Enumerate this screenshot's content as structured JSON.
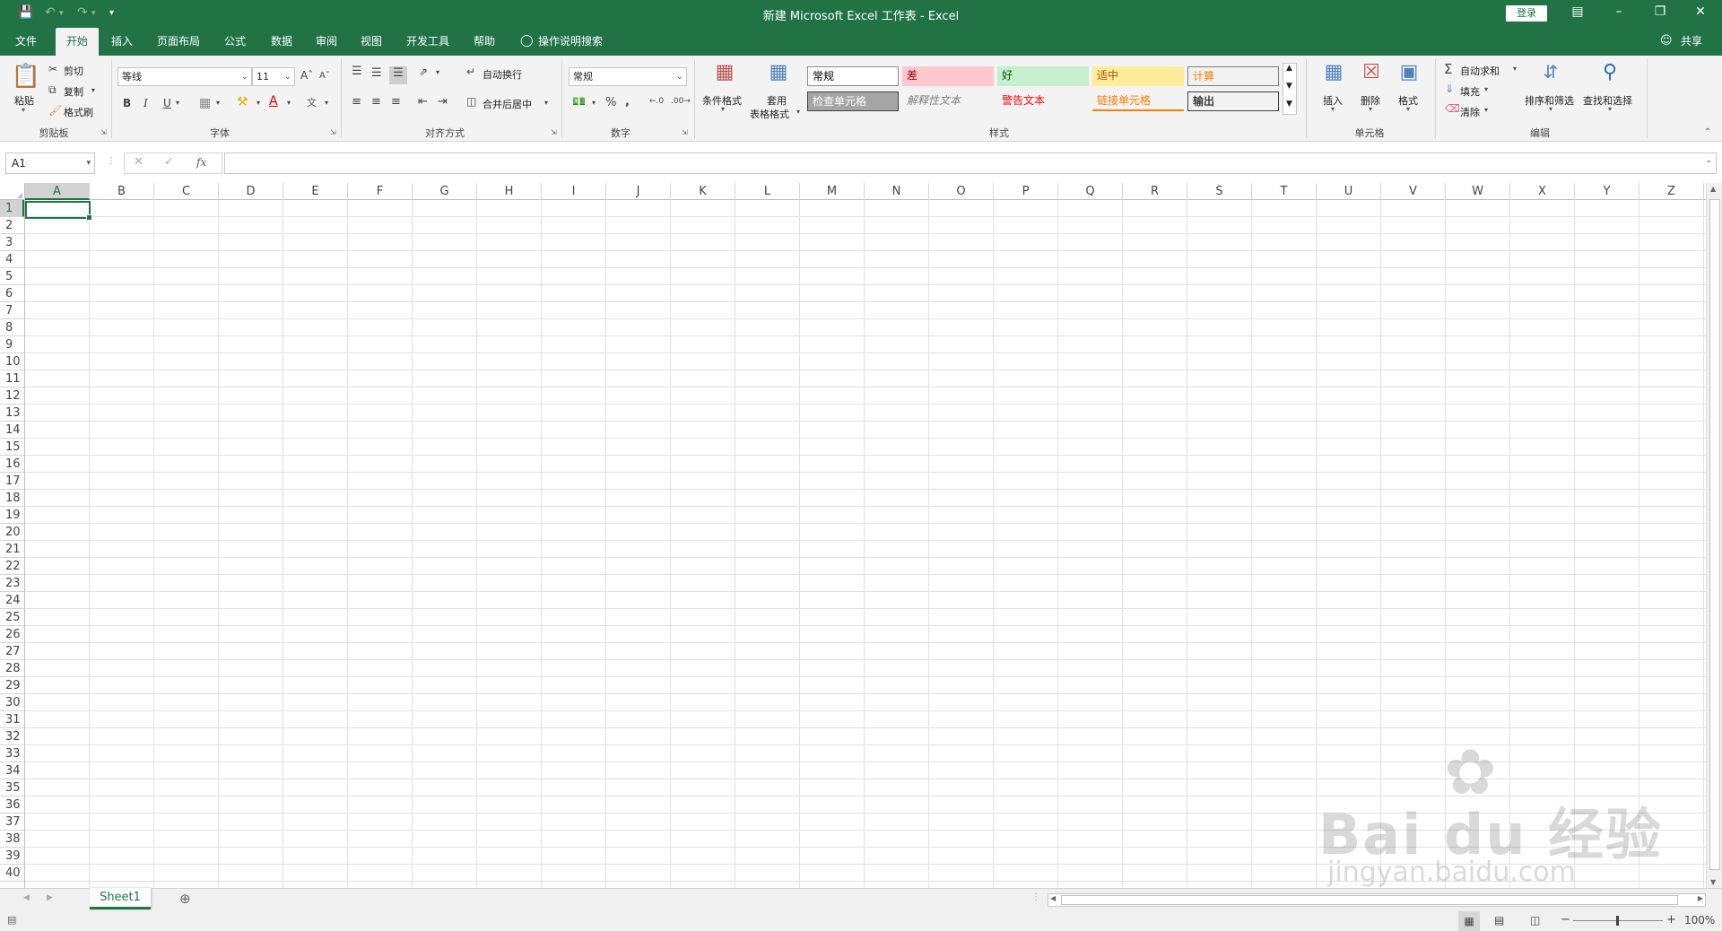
{
  "window": {
    "title": "新建 Microsoft Excel 工作表  -  Excel",
    "login_label": "登录"
  },
  "tabs": [
    {
      "label": "文件",
      "active": false
    },
    {
      "label": "开始",
      "active": true
    },
    {
      "label": "插入",
      "active": false
    },
    {
      "label": "页面布局",
      "active": false
    },
    {
      "label": "公式",
      "active": false
    },
    {
      "label": "数据",
      "active": false
    },
    {
      "label": "审阅",
      "active": false
    },
    {
      "label": "视图",
      "active": false
    },
    {
      "label": "开发工具",
      "active": false
    },
    {
      "label": "帮助",
      "active": false
    }
  ],
  "tell_me": "操作说明搜索",
  "share_label": "共享",
  "clipboard": {
    "paste": "粘贴",
    "cut": "剪切",
    "copy": "复制",
    "format_painter": "格式刷",
    "group": "剪贴板"
  },
  "font": {
    "name": "等线",
    "size": "11",
    "bold": "B",
    "italic": "I",
    "underline": "U",
    "group": "字体"
  },
  "alignment": {
    "wrap": "自动换行",
    "merge": "合并后居中",
    "group": "对齐方式"
  },
  "number": {
    "format": "常规",
    "group": "数字"
  },
  "styles": {
    "conditional": "条件格式",
    "table_line1": "套用",
    "table_line2": "表格格式",
    "cells": [
      {
        "label": "常规",
        "bg": "#ffffff",
        "color": "#000000",
        "border": "#8c8c8c"
      },
      {
        "label": "差",
        "bg": "#ffc7ce",
        "color": "#9c0006",
        "border": "none"
      },
      {
        "label": "好",
        "bg": "#c6efce",
        "color": "#006100",
        "border": "none"
      },
      {
        "label": "适中",
        "bg": "#ffeb9c",
        "color": "#9c5700",
        "border": "none"
      },
      {
        "label": "计算",
        "bg": "#f2f2f2",
        "color": "#fa7d00",
        "border": "#7f7f7f"
      },
      {
        "label": "检查单元格",
        "bg": "#a5a5a5",
        "color": "#ffffff",
        "border": "#3f3f3f"
      },
      {
        "label": "解释性文本",
        "bg": "#f3f3f3",
        "color": "#7f7f7f",
        "border": "none"
      },
      {
        "label": "警告文本",
        "bg": "#f3f3f3",
        "color": "#ff0000",
        "border": "none"
      },
      {
        "label": "链接单元格",
        "bg": "#f3f3f3",
        "color": "#fa7d00",
        "border": "none"
      },
      {
        "label": "输出",
        "bg": "#f2f2f2",
        "color": "#3f3f3f",
        "border": "#3f3f3f"
      }
    ],
    "group": "样式"
  },
  "cells_group": {
    "insert": "插入",
    "delete": "删除",
    "format": "格式",
    "group": "单元格"
  },
  "editing": {
    "autosum": "自动求和",
    "fill": "填充",
    "clear": "清除",
    "sort": "排序和筛选",
    "find": "查找和选择",
    "group": "编辑"
  },
  "formula_bar": {
    "name_box": "A1",
    "fx": "fx",
    "content": ""
  },
  "columns": [
    "A",
    "B",
    "C",
    "D",
    "E",
    "F",
    "G",
    "H",
    "I",
    "J",
    "K",
    "L",
    "M",
    "N",
    "O",
    "P",
    "Q",
    "R",
    "S",
    "T",
    "U",
    "V",
    "W",
    "X",
    "Y",
    "Z"
  ],
  "rows": [
    "1",
    "2",
    "3",
    "4",
    "5",
    "6",
    "7",
    "8",
    "9",
    "10",
    "11",
    "12",
    "13",
    "14",
    "15",
    "16",
    "17",
    "18",
    "19",
    "20",
    "21",
    "22",
    "23",
    "24",
    "25",
    "26",
    "27",
    "28",
    "29",
    "30",
    "31",
    "32",
    "33",
    "34",
    "35",
    "36",
    "37",
    "38",
    "39",
    "40"
  ],
  "active_cell": "A1",
  "sheets": [
    {
      "label": "Sheet1",
      "active": true
    }
  ],
  "status": {
    "zoom": "100%"
  },
  "watermark": {
    "logo": "Bai du 经验",
    "url": "jingyan.baidu.com"
  },
  "colors": {
    "accent": "#217346"
  }
}
